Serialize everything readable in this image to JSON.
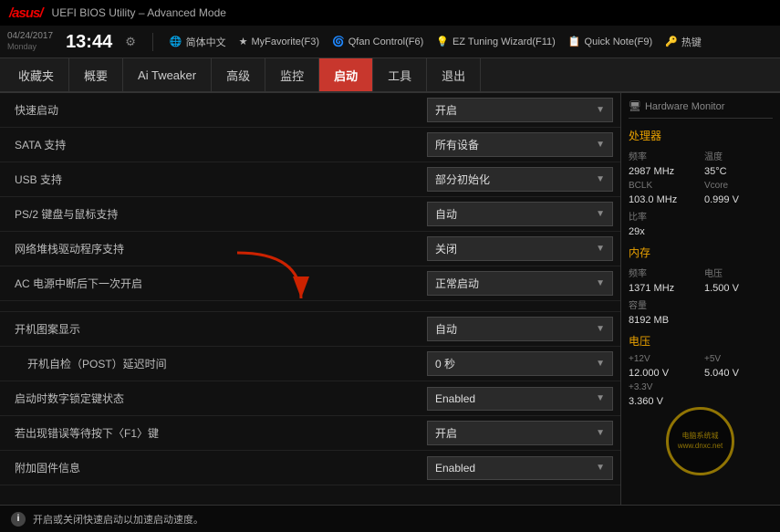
{
  "titlebar": {
    "logo": "/asus/",
    "title": "UEFI BIOS Utility – Advanced Mode"
  },
  "topbar": {
    "date": "04/24/2017",
    "day": "Monday",
    "time": "13:44",
    "items": [
      {
        "icon": "⚙",
        "label": "简体中文"
      },
      {
        "icon": "★",
        "label": "MyFavorite(F3)"
      },
      {
        "icon": "🌀",
        "label": "Qfan Control(F6)"
      },
      {
        "icon": "💡",
        "label": "EZ Tuning Wizard(F11)"
      },
      {
        "icon": "📝",
        "label": "Quick Note(F9)"
      },
      {
        "icon": "🔑",
        "label": "热键"
      }
    ]
  },
  "nav": {
    "items": [
      {
        "label": "收藏夹",
        "active": false
      },
      {
        "label": "概要",
        "active": false
      },
      {
        "label": "Ai Tweaker",
        "active": false
      },
      {
        "label": "高级",
        "active": false
      },
      {
        "label": "监控",
        "active": false
      },
      {
        "label": "启动",
        "active": true
      },
      {
        "label": "工具",
        "active": false
      },
      {
        "label": "退出",
        "active": false
      }
    ]
  },
  "settings": {
    "rows": [
      {
        "label": "快速启动",
        "value": "开启",
        "indent": false,
        "type": "dropdown",
        "section": false
      },
      {
        "label": "SATA 支持",
        "value": "所有设备",
        "indent": false,
        "type": "dropdown",
        "section": false
      },
      {
        "label": "USB 支持",
        "value": "部分初始化",
        "indent": false,
        "type": "dropdown",
        "section": false
      },
      {
        "label": "PS/2 键盘与鼠标支持",
        "value": "自动",
        "indent": false,
        "type": "dropdown",
        "section": false
      },
      {
        "label": "网络堆栈驱动程序支持",
        "value": "关闭",
        "indent": false,
        "type": "dropdown",
        "section": false
      },
      {
        "label": "AC 电源中断后下一次开启",
        "value": "正常启动",
        "indent": false,
        "type": "dropdown",
        "section": false
      },
      {
        "label": "",
        "value": "",
        "indent": false,
        "type": "spacer",
        "section": false
      },
      {
        "label": "开机图案显示",
        "value": "自动",
        "indent": false,
        "type": "dropdown",
        "section": false
      },
      {
        "label": "开机自检（POST）延迟时间",
        "value": "0 秒",
        "indent": true,
        "type": "dropdown",
        "section": false
      },
      {
        "label": "启动时数字锁定键状态",
        "value": "Enabled",
        "indent": false,
        "type": "dropdown",
        "section": false
      },
      {
        "label": "若出现错误等待按下〈F1〉键",
        "value": "开启",
        "indent": false,
        "type": "dropdown",
        "section": false
      },
      {
        "label": "附加固件信息",
        "value": "Enabled",
        "indent": false,
        "type": "dropdown",
        "section": false
      }
    ]
  },
  "hardware_monitor": {
    "title": "Hardware Monitor",
    "sections": [
      {
        "title": "处理器",
        "items": [
          {
            "label": "频率",
            "value": "2987 MHz"
          },
          {
            "label": "温度",
            "value": "35°C"
          },
          {
            "label": "BCLK",
            "value": "103.0 MHz"
          },
          {
            "label": "Vcore",
            "value": "0.999 V"
          },
          {
            "label": "比率",
            "value": "29x",
            "full": false
          },
          {
            "label": "",
            "value": "",
            "full": false
          }
        ]
      },
      {
        "title": "内存",
        "items": [
          {
            "label": "频率",
            "value": "1371 MHz"
          },
          {
            "label": "电压",
            "value": "1.500 V"
          },
          {
            "label": "容量",
            "value": "8192 MB",
            "full": true
          }
        ]
      },
      {
        "title": "电压",
        "items": [
          {
            "label": "+12V",
            "value": "12.000 V"
          },
          {
            "label": "+5V",
            "value": "5.040 V"
          },
          {
            "label": "+3.3V",
            "value": "3.360 V",
            "full": true
          }
        ]
      }
    ]
  },
  "status_bar": {
    "text": "开启或关闭快速启动以加速启动速度。"
  }
}
